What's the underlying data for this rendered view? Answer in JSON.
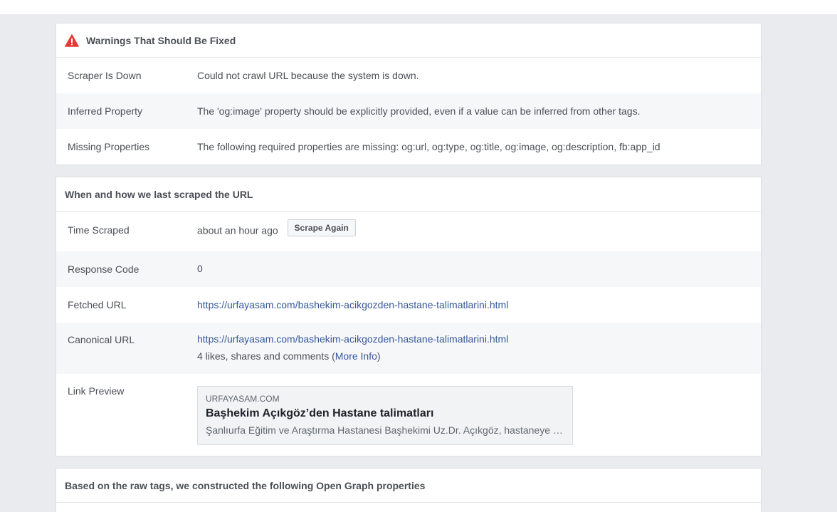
{
  "warnings": {
    "title": "Warnings That Should Be Fixed",
    "rows": [
      {
        "label": "Scraper Is Down",
        "value": "Could not crawl URL because the system is down."
      },
      {
        "label": "Inferred Property",
        "value": "The 'og:image' property should be explicitly provided, even if a value can be inferred from other tags."
      },
      {
        "label": "Missing Properties",
        "value": "The following required properties are missing: og:url, og:type, og:title, og:image, og:description, fb:app_id"
      }
    ]
  },
  "scrape": {
    "title": "When and how we last scraped the URL",
    "time_label": "Time Scraped",
    "time_value": "about an hour ago",
    "scrape_again": "Scrape Again",
    "response_label": "Response Code",
    "response_value": "0",
    "fetched_label": "Fetched URL",
    "fetched_url": "https://urfayasam.com/bashekim-acikgozden-hastane-talimatlarini.html",
    "canonical_label": "Canonical URL",
    "canonical_url": "https://urfayasam.com/bashekim-acikgozden-hastane-talimatlarini.html",
    "engagement_prefix": "4 likes, shares and comments (",
    "more_info": "More Info",
    "engagement_suffix": ")",
    "preview_label": "Link Preview",
    "preview": {
      "domain": "URFAYASAM.COM",
      "title": "Başhekim Açıkgöz’den Hastane talimatları",
      "description": "Şanlıurfa Eğitim ve Araştırma Hastanesi Başhekimi Uz.Dr. Açıkgöz, hastaneye personel ile vatandaşların işlemlerinin daha hızlı yapılması için talimatlar verdi."
    }
  },
  "og": {
    "title": "Based on the raw tags, we constructed the following Open Graph properties"
  },
  "colors": {
    "page_background": "#e9ebee",
    "warning_icon": "#e53935",
    "link": "#365899"
  }
}
